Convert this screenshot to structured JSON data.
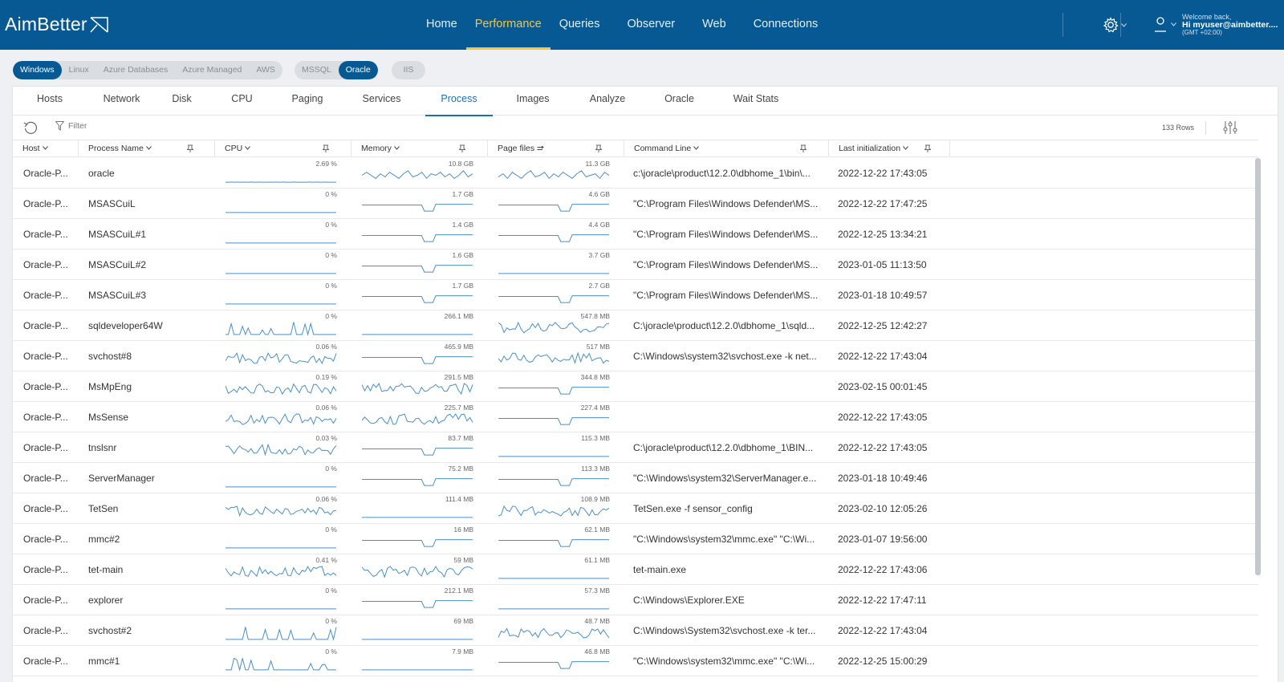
{
  "header": {
    "logo": "AimBetter",
    "nav": [
      "Home",
      "Performance",
      "Queries",
      "Observer",
      "Web",
      "Connections"
    ],
    "active_nav": "Performance",
    "welcome": "Welcome back,",
    "user": "Hi myuser@aimbetter....",
    "timezone": "(GMT +02:00)"
  },
  "chips": {
    "os": [
      "Windows",
      "Linux",
      "Azure Databases",
      "Azure Managed",
      "AWS"
    ],
    "os_active": "Windows",
    "db": [
      "MSSQL",
      "Oracle"
    ],
    "db_active": "Oracle",
    "web": [
      "IIS"
    ]
  },
  "tabs": [
    "Hosts",
    "Network",
    "Disk",
    "CPU",
    "Paging",
    "Services",
    "Process",
    "Images",
    "Analyze",
    "Oracle",
    "Wait Stats"
  ],
  "active_tab": "Process",
  "toolbar": {
    "filter_label": "Filter",
    "row_count": "133 Rows"
  },
  "columns": [
    "Host",
    "Process Name",
    "CPU",
    "Memory",
    "Page files",
    "Command Line",
    "Last initialization"
  ],
  "rows": [
    {
      "host": "Oracle-P...",
      "name": "oracle",
      "cpu": "2.69 %",
      "mem": "10.8 GB",
      "page": "11.3 GB",
      "cmd": "c:\\joracle\\product\\12.2.0\\dbhome_1\\bin\\...",
      "init": "2022-12-22 17:43:05",
      "cpu_trend": [
        0.05,
        0.05,
        0.05,
        0.05,
        0.06,
        0.05,
        0.05,
        0.06,
        0.05,
        0.05,
        0.05,
        0.06,
        0.05,
        0.05,
        0.05,
        0.05,
        0.06,
        0.05,
        0.05,
        0.05,
        0.05,
        0.06,
        0.05,
        0.05,
        0.05,
        0.05,
        0.05,
        0.05,
        0.06,
        0.05,
        0.05,
        0.05,
        0.06,
        0.05,
        0.05,
        0.05,
        0.06,
        0.05,
        0.05,
        0.05,
        0.05,
        0.05,
        0.05,
        0.06,
        0.05,
        0.05,
        0.05,
        0.05,
        0.05,
        0.05,
        0.05,
        0.05,
        0.06,
        0.05,
        0.05,
        0.05,
        0.05,
        0.06,
        0.05,
        0.05,
        0.05,
        0.05,
        0.06,
        0.05,
        0.05,
        0.05,
        0.05,
        0.05,
        0.05,
        0.05
      ],
      "mem_trend": [
        0.5,
        0.7,
        0.5,
        0.3,
        0.6,
        0.4,
        0.7,
        0.5,
        0.3,
        0.6,
        0.8,
        0.4,
        0.5,
        0.7,
        0.3,
        0.6,
        0.5,
        0.7,
        0.4,
        0.6,
        0.3,
        0.5,
        0.8,
        0.4,
        0.6
      ],
      "page_trend": [
        0.4,
        0.6,
        0.3,
        0.7,
        0.5,
        0.3,
        0.6,
        0.8,
        0.4,
        0.5,
        0.7,
        0.3,
        0.6,
        0.4,
        0.7,
        0.5,
        0.3,
        0.6,
        0.8,
        0.4,
        0.5,
        0.6,
        0.3,
        0.7,
        0.5
      ]
    },
    {
      "host": "Oracle-P...",
      "name": "MSASCuiL",
      "cpu": "0 %",
      "mem": "1.7 GB",
      "page": "4.6 GB",
      "cmd": "\"C:\\Program Files\\Windows Defender\\MS...",
      "init": "2022-12-22 17:47:25"
    },
    {
      "host": "Oracle-P...",
      "name": "MSASCuiL#1",
      "cpu": "0 %",
      "mem": "1.4 GB",
      "page": "4.4 GB",
      "cmd": "\"C:\\Program Files\\Windows Defender\\MS...",
      "init": "2022-12-25 13:34:21"
    },
    {
      "host": "Oracle-P...",
      "name": "MSASCuiL#2",
      "cpu": "0 %",
      "mem": "1.6 GB",
      "page": "3.7 GB",
      "cmd": "\"C:\\Program Files\\Windows Defender\\MS...",
      "init": "2023-01-05 11:13:50"
    },
    {
      "host": "Oracle-P...",
      "name": "MSASCuiL#3",
      "cpu": "0 %",
      "mem": "1.7 GB",
      "page": "2.7 GB",
      "cmd": "\"C:\\Program Files\\Windows Defender\\MS...",
      "init": "2023-01-18 10:49:57"
    },
    {
      "host": "Oracle-P...",
      "name": "sqldeveloper64W",
      "cpu": "0 %",
      "mem": "266.1 MB",
      "page": "547.8 MB",
      "cmd": "C:\\joracle\\product\\12.2.0\\dbhome_1\\sqld...",
      "init": "2022-12-25 12:42:27"
    },
    {
      "host": "Oracle-P...",
      "name": "svchost#8",
      "cpu": "0.06 %",
      "mem": "465.9 MB",
      "page": "517 MB",
      "cmd": "C:\\Windows\\system32\\svchost.exe -k net...",
      "init": "2022-12-22 17:43:04"
    },
    {
      "host": "Oracle-P...",
      "name": "MsMpEng",
      "cpu": "0.19 %",
      "mem": "291.5 MB",
      "page": "344.8 MB",
      "cmd": "",
      "init": "2023-02-15 00:01:45"
    },
    {
      "host": "Oracle-P...",
      "name": "MsSense",
      "cpu": "0.06 %",
      "mem": "225.7 MB",
      "page": "227.4 MB",
      "cmd": "",
      "init": "2022-12-22 17:43:05"
    },
    {
      "host": "Oracle-P...",
      "name": "tnslsnr",
      "cpu": "0.03 %",
      "mem": "83.7 MB",
      "page": "115.3 MB",
      "cmd": "C:\\joracle\\product\\12.2.0\\dbhome_1\\BIN...",
      "init": "2022-12-22 17:43:05"
    },
    {
      "host": "Oracle-P...",
      "name": "ServerManager",
      "cpu": "0 %",
      "mem": "75.2 MB",
      "page": "113.3 MB",
      "cmd": "\"C:\\Windows\\system32\\ServerManager.e...",
      "init": "2023-01-18 10:49:46"
    },
    {
      "host": "Oracle-P...",
      "name": "TetSen",
      "cpu": "0.06 %",
      "mem": "111.4 MB",
      "page": "108.9 MB",
      "cmd": "TetSen.exe -f sensor_config",
      "init": "2023-02-10 12:05:26"
    },
    {
      "host": "Oracle-P...",
      "name": "mmc#2",
      "cpu": "0 %",
      "mem": "16 MB",
      "page": "62.1 MB",
      "cmd": "\"C:\\Windows\\system32\\mmc.exe\" \"C:\\Wi...",
      "init": "2023-01-07 19:56:00"
    },
    {
      "host": "Oracle-P...",
      "name": "tet-main",
      "cpu": "0.41 %",
      "mem": "59 MB",
      "page": "61.1 MB",
      "cmd": "tet-main.exe",
      "init": "2022-12-22 17:43:06"
    },
    {
      "host": "Oracle-P...",
      "name": "explorer",
      "cpu": "0 %",
      "mem": "212.1 MB",
      "page": "57.3 MB",
      "cmd": "C:\\Windows\\Explorer.EXE",
      "init": "2022-12-22 17:47:11"
    },
    {
      "host": "Oracle-P...",
      "name": "svchost#2",
      "cpu": "0 %",
      "mem": "69 MB",
      "page": "48.7 MB",
      "cmd": "C:\\Windows\\System32\\svchost.exe -k ter...",
      "init": "2022-12-22 17:43:04"
    },
    {
      "host": "Oracle-P...",
      "name": "mmc#1",
      "cpu": "0 %",
      "mem": "7.9 MB",
      "page": "46.8 MB",
      "cmd": "\"C:\\Windows\\system32\\mmc.exe\" \"C:\\Wi...",
      "init": "2022-12-25 15:00:29"
    }
  ],
  "colors": {
    "header_bg": "#075994",
    "active_nav": "#f7c63c",
    "accent": "#1b6fb5",
    "spark": "#4a8fc7"
  }
}
